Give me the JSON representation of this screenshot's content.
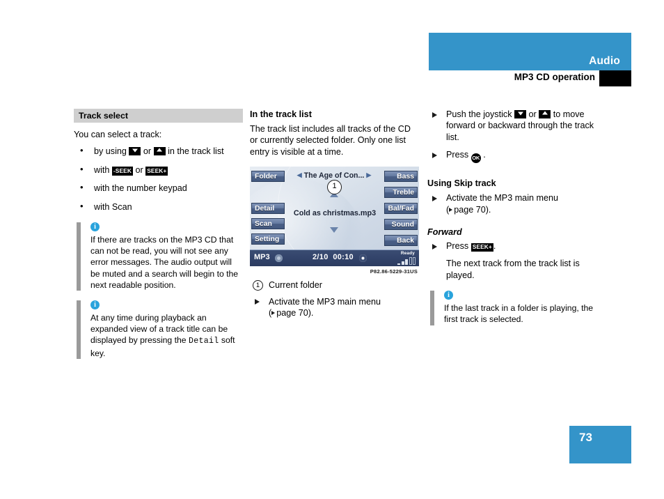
{
  "header": {
    "title": "Audio",
    "subtitle": "MP3 CD operation",
    "band_color": "#3494c9"
  },
  "page_number": "73",
  "left_column": {
    "section_title": "Track select",
    "intro": "You can select a track:",
    "bullets": [
      {
        "prefix": "by using",
        "key1": "▼",
        "mid": "or",
        "key2": "▲",
        "suffix": "in the track list"
      },
      {
        "prefix": "with",
        "key1": "-SEEK",
        "mid": "or",
        "key2": "SEEK+",
        "suffix": ""
      },
      {
        "text": "with the number keypad"
      },
      {
        "text": "with Scan"
      }
    ],
    "notes": [
      {
        "icon": "info-icon",
        "text": "If there are tracks on the MP3 CD that can not be read, you will not see any error messages. The audio output will be muted and a search will begin to the next readable position."
      },
      {
        "icon": "info-icon",
        "text_before": "At any time during playback an expanded view of a track title can be displayed by pressing the",
        "mono": "Detail",
        "text_after": "soft key."
      }
    ]
  },
  "middle_column": {
    "heading": "In the track list",
    "paragraph": "The track list includes all tracks of the CD or currently selected folder. Only one list entry is visible at a time.",
    "display": {
      "left_softkeys": [
        "Folder",
        "Detail",
        "Scan",
        "Setting"
      ],
      "right_softkeys": [
        "Bass",
        "Treble",
        "Bal/Fad",
        "Sound",
        "Back"
      ],
      "folder_name": "The Age of Con...",
      "callout_number": "1",
      "track_name": "Cold as christmas.mp3",
      "status_source": "MP3",
      "status_track": "2/10",
      "status_time": "00:10",
      "status_ready": "Ready"
    },
    "caption": "P82.86-5229-31US",
    "callout_legend": {
      "number": "1",
      "label": "Current folder"
    },
    "step": {
      "line1": "Activate the MP3 main menu",
      "line2_ref": "page 70"
    }
  },
  "right_column": {
    "steps": [
      {
        "before": "Push the joystick",
        "key1": "▼",
        "mid": "or",
        "key2": "▲",
        "after": "to move forward or backward through the track list."
      },
      {
        "before": "Press",
        "key_ok": "OK",
        "after": "."
      }
    ],
    "heading": "Using Skip track",
    "activate_step": {
      "line1": "Activate the MP3 main menu",
      "line2_ref": "page 70"
    },
    "forward_heading": "Forward",
    "press_step": {
      "before": "Press",
      "key": "SEEK+",
      "after": "."
    },
    "result_text": "The next track from the track list is played.",
    "note": {
      "icon": "info-icon",
      "text": "If the last track in a folder is playing, the first track is selected."
    }
  }
}
